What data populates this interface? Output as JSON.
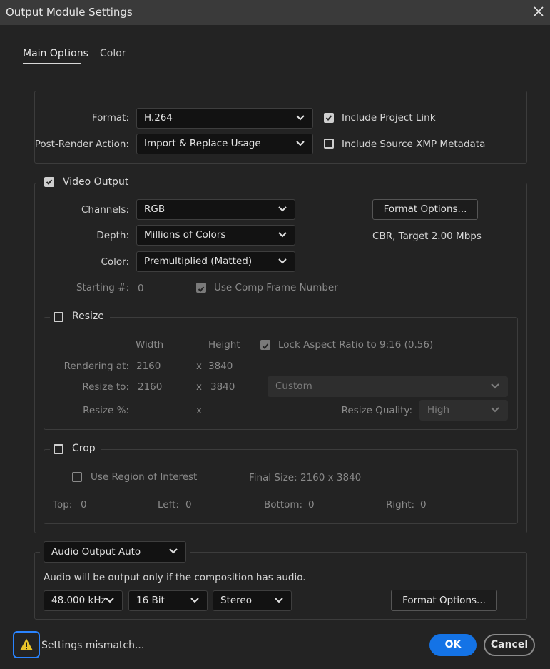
{
  "window": {
    "title": "Output Module Settings"
  },
  "tabs": {
    "main": "Main Options",
    "color": "Color"
  },
  "format_section": {
    "format_label": "Format:",
    "format_value": "H.264",
    "post_render_label": "Post-Render Action:",
    "post_render_value": "Import & Replace Usage",
    "include_project_link": {
      "label": "Include Project Link",
      "checked": true
    },
    "include_xmp": {
      "label": "Include Source XMP Metadata",
      "checked": false
    }
  },
  "video_output": {
    "title": "Video Output",
    "checked": true,
    "channels_label": "Channels:",
    "channels_value": "RGB",
    "depth_label": "Depth:",
    "depth_value": "Millions of Colors",
    "color_label": "Color:",
    "color_value": "Premultiplied (Matted)",
    "format_options_button": "Format Options...",
    "format_info": "CBR, Target 2.00 Mbps",
    "starting_label": "Starting #:",
    "starting_value": "0",
    "use_comp_frame": {
      "label": "Use Comp Frame Number",
      "checked": true
    }
  },
  "resize": {
    "title": "Resize",
    "checked": false,
    "width_header": "Width",
    "height_header": "Height",
    "lock_aspect": {
      "label": "Lock Aspect Ratio to 9:16 (0.56)",
      "checked": true
    },
    "rendering_at_label": "Rendering at:",
    "rendering_w": "2160",
    "rendering_h": "3840",
    "resize_to_label": "Resize to:",
    "resize_w": "2160",
    "resize_h": "3840",
    "preset_value": "Custom",
    "resize_pct_label": "Resize %:",
    "x_sep": "x",
    "quality_label": "Resize Quality:",
    "quality_value": "High"
  },
  "crop": {
    "title": "Crop",
    "checked": false,
    "use_roi": {
      "label": "Use Region of Interest",
      "checked": false
    },
    "final_size": "Final Size: 2160 x 3840",
    "top_label": "Top:",
    "top_value": "0",
    "left_label": "Left:",
    "left_value": "0",
    "bottom_label": "Bottom:",
    "bottom_value": "0",
    "right_label": "Right:",
    "right_value": "0"
  },
  "audio": {
    "mode_value": "Audio Output Auto",
    "note": "Audio will be output only if the composition has audio.",
    "rate_value": "48.000 kHz",
    "bits_value": "16 Bit",
    "channels_value": "Stereo",
    "format_options_button": "Format Options..."
  },
  "footer": {
    "warning_text": "Settings mismatch...",
    "ok": "OK",
    "cancel": "Cancel"
  },
  "colors": {
    "accent": "#1473e6",
    "warning": "#e8c32a",
    "focus": "#2a84ff"
  }
}
